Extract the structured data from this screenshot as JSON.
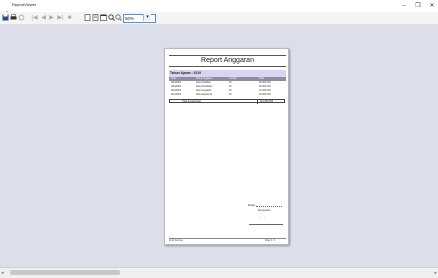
{
  "window": {
    "title": "ReportViewer",
    "minimize": "–",
    "maximize": "❐",
    "close": "✕"
  },
  "toolbar": {
    "save_icon": "floppy-icon",
    "print_icon": "printer-icon",
    "refresh_icon": "refresh-icon",
    "first": "|◀",
    "prev": "◀",
    "next": "▶",
    "last": "▶|",
    "stop": "■",
    "page_setup_icon": "page-setup-icon",
    "layout_icon": "print-layout-icon",
    "export_icon": "export-icon",
    "zoom_in": "🔍",
    "zoom_out": "🔍",
    "zoom_value": "50%",
    "zoom_dropdown": "▾"
  },
  "report": {
    "title": "Report Anggaran",
    "section_label": "Tahun Ajaran : 2019",
    "columns": [
      "Kode",
      "Nama Anggaran",
      "Jumlah",
      "Total"
    ],
    "rows": [
      [
        "ANG0001",
        "Dana Fasilitas",
        "20",
        "50.000.000"
      ],
      [
        "ANG0002",
        "Dana Perbaikan",
        "20",
        "30.000.000"
      ],
      [
        "ANG0003",
        "Dana Kegiatan",
        "20",
        "10.000.000"
      ],
      [
        "ANG0004",
        "Dana Akademik",
        "20",
        "20.000.000"
      ]
    ],
    "total_label": "Total Keseluruhan",
    "total_value": "110.000.000",
    "signature_city": "Medan ,",
    "signature_role": "Mengetahui",
    "signature_name": "( ... )",
    "footer_left": "Ali Al Farrouq",
    "footer_right": "Page 1 / 1"
  },
  "scroll": {
    "left": "◂",
    "right": "▸"
  }
}
